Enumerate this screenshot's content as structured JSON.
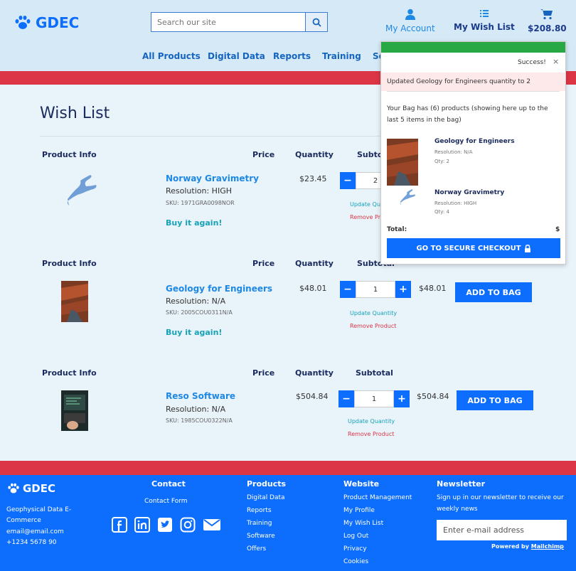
{
  "header": {
    "logo_text": "GDEC",
    "search_placeholder": "Search our site",
    "my_account": "My Account",
    "my_wish_list": "My Wish List",
    "cart_total": "$208.80"
  },
  "nav": [
    "All Products",
    "Digital Data",
    "Reports",
    "Training",
    "Sc"
  ],
  "page_title": "Wish List",
  "columns": {
    "product_info": "Product Info",
    "price": "Price",
    "quantity": "Quantity",
    "subtotal": "Subtotal"
  },
  "products": [
    {
      "name": "Norway Gravimetry",
      "resolution": "Resolution: HIGH",
      "sku": "SKU: 1971GRA0098NOR",
      "buy_again": "Buy it again!",
      "price": "$23.45",
      "qty": "2",
      "subtotal": "",
      "update": "Update Quantity",
      "remove": "Remove Product",
      "add": ""
    },
    {
      "name": "Geology for Engineers",
      "resolution": "Resolution: N/A",
      "sku": "SKU: 2005COU0311N/A",
      "buy_again": "Buy it again!",
      "price": "$48.01",
      "qty": "1",
      "subtotal": "$48.01",
      "update": "Update Quantity",
      "remove": "Remove Product",
      "add": "ADD TO BAG"
    },
    {
      "name": "Reso Software",
      "resolution": "Resolution: N/A",
      "sku": "SKU: 1985COU0322N/A",
      "buy_again": "",
      "price": "$504.84",
      "qty": "1",
      "subtotal": "$504.84",
      "update": "Update Quantity",
      "remove": "Remove Product",
      "add": "ADD TO BAG"
    }
  ],
  "toast": {
    "success": "Success!",
    "close": "×",
    "message": "Updated Geology for Engineers quantity to 2",
    "info": "Your Bag has (6) products (showing here up to the last 5 items in the bag)",
    "items": [
      {
        "name": "Geology for Engineers",
        "resolution": "Resolution: N/A",
        "qty": "Qty: 2"
      },
      {
        "name": "Norway Gravimetry",
        "resolution": "Resolution: HIGH",
        "qty": "Qty: 4"
      }
    ],
    "total_label": "Total:",
    "total_value": "$",
    "checkout": "GO TO SECURE CHECKOUT"
  },
  "footer": {
    "logo_text": "GDEC",
    "company": "Geophysical Data E-Commerce",
    "email": "email@email.com",
    "phone": "+1234 5678 90",
    "contact_heading": "Contact",
    "contact_form": "Contact Form",
    "products_heading": "Products",
    "products": [
      "Digital Data",
      "Reports",
      "Training",
      "Software",
      "Offers"
    ],
    "website_heading": "Website",
    "website": [
      "Product Management",
      "My Profile",
      "My Wish List",
      "Log Out",
      "Privacy",
      "Cookies"
    ],
    "newsletter_heading": "Newsletter",
    "newsletter_text": "Sign up in our newsletter to receive our weekly news",
    "email_placeholder": "Enter e-mail address",
    "powered_prefix": "Powered by ",
    "powered_brand": "Mailchimp"
  },
  "colors": {
    "primary": "#0d6efd",
    "danger": "#dc3545",
    "success": "#28a745",
    "header_bg": "#d6e9f7"
  }
}
